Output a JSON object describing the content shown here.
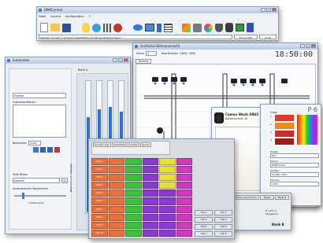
{
  "main_window": {
    "title": "DMXControl",
    "menu": [
      "Datei",
      "Ansicht",
      "Konfiguration",
      "?"
    ],
    "path_text": "Aktueller Projekt: C:\\Program Files\\DMXControl\\Projects\\Demo\\Demo",
    "date": "15.01.2007",
    "time": "17:00"
  },
  "submaster": {
    "title": "Submaster",
    "dropdown_value": "Dunkel",
    "list_label": "Submaster-Blöcke",
    "name_label": "Bankname:",
    "name_value": "Profix",
    "mode_label": "Fade-Modus",
    "mode_value": "Normal",
    "auto_label": "Automatisches Überblenden",
    "seconds": "1 Sekunde(n)",
    "bank_label": "Bank A",
    "channel_vertical": "DMX auf Ch.1: Helligkeit"
  },
  "stage": {
    "title": "Grafische Bühnenansicht",
    "zoom_label": "Zoom",
    "zoom_value": "1",
    "coords": "Koordinaten: 1600, 1600",
    "clock": "18:50:00",
    "tab": "Default"
  },
  "device": {
    "title": "Cameo Wash XR63",
    "subtitle": "Kanalnummer: 26",
    "code": "P 6"
  },
  "colorpicker": {
    "section": "Color",
    "slots": [
      "1",
      "2",
      "3",
      "4"
    ],
    "labels": [
      "Enable",
      "Modus",
      "Shutter",
      "Dimmer"
    ],
    "values": [
      "Rot",
      "PWM-Farbe",
      "Shutter offen",
      "100%"
    ]
  },
  "sequencer": {
    "tabs": [
      "Einstellungen",
      "Befehlsliste",
      "Geräte",
      "Szenen"
    ],
    "row_labels": [
      "Titel 1",
      "Titel 2",
      "Titel 3",
      "Titel 4",
      "Titel 5",
      "Titel 6",
      "Titel 7",
      "Titel 8",
      "Titel 9",
      "Titel 10"
    ],
    "footer_buttons": [
      "Start",
      "Stop",
      "Pause",
      "Weiter"
    ],
    "right_buttons": [
      "Titel 1",
      "Titel 2",
      "Titel 3",
      "Titel 4",
      "Titel 5",
      "Titel 6",
      "Titel 7",
      "Titel 8"
    ]
  },
  "bankb": {
    "tabs": [
      "Lampe abschalten",
      "Reset",
      "Bank B"
    ],
    "footer": "Bank B",
    "sub": "B nicht & Sequenzer"
  },
  "colors": {
    "titlebar": "#b9c9de",
    "bar_blue": "#2f6fd6",
    "grid_orange": "#e8703a",
    "grid_green": "#3fbf3a",
    "grid_purple": "#8a3ad0",
    "grid_magenta": "#d03ac0",
    "grid_yellow": "#e8e03a"
  }
}
